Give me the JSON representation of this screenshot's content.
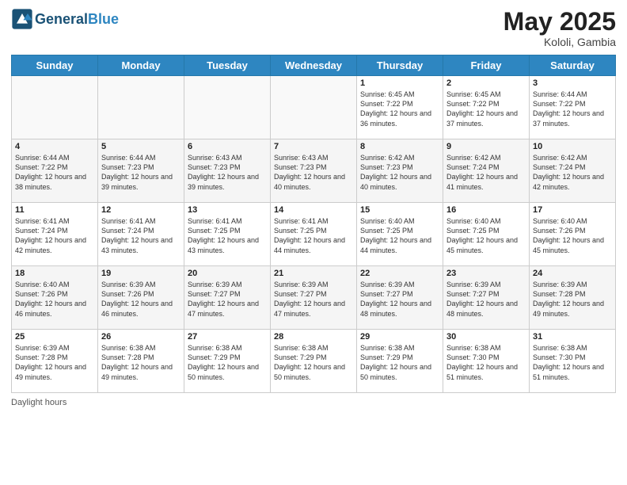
{
  "logo": {
    "general": "General",
    "blue": "Blue"
  },
  "title": "May 2025",
  "subtitle": "Kololi, Gambia",
  "days_of_week": [
    "Sunday",
    "Monday",
    "Tuesday",
    "Wednesday",
    "Thursday",
    "Friday",
    "Saturday"
  ],
  "weeks": [
    [
      {
        "day": "",
        "info": ""
      },
      {
        "day": "",
        "info": ""
      },
      {
        "day": "",
        "info": ""
      },
      {
        "day": "",
        "info": ""
      },
      {
        "day": "1",
        "info": "Sunrise: 6:45 AM\nSunset: 7:22 PM\nDaylight: 12 hours and 36 minutes."
      },
      {
        "day": "2",
        "info": "Sunrise: 6:45 AM\nSunset: 7:22 PM\nDaylight: 12 hours and 37 minutes."
      },
      {
        "day": "3",
        "info": "Sunrise: 6:44 AM\nSunset: 7:22 PM\nDaylight: 12 hours and 37 minutes."
      }
    ],
    [
      {
        "day": "4",
        "info": "Sunrise: 6:44 AM\nSunset: 7:22 PM\nDaylight: 12 hours and 38 minutes."
      },
      {
        "day": "5",
        "info": "Sunrise: 6:44 AM\nSunset: 7:23 PM\nDaylight: 12 hours and 39 minutes."
      },
      {
        "day": "6",
        "info": "Sunrise: 6:43 AM\nSunset: 7:23 PM\nDaylight: 12 hours and 39 minutes."
      },
      {
        "day": "7",
        "info": "Sunrise: 6:43 AM\nSunset: 7:23 PM\nDaylight: 12 hours and 40 minutes."
      },
      {
        "day": "8",
        "info": "Sunrise: 6:42 AM\nSunset: 7:23 PM\nDaylight: 12 hours and 40 minutes."
      },
      {
        "day": "9",
        "info": "Sunrise: 6:42 AM\nSunset: 7:24 PM\nDaylight: 12 hours and 41 minutes."
      },
      {
        "day": "10",
        "info": "Sunrise: 6:42 AM\nSunset: 7:24 PM\nDaylight: 12 hours and 42 minutes."
      }
    ],
    [
      {
        "day": "11",
        "info": "Sunrise: 6:41 AM\nSunset: 7:24 PM\nDaylight: 12 hours and 42 minutes."
      },
      {
        "day": "12",
        "info": "Sunrise: 6:41 AM\nSunset: 7:24 PM\nDaylight: 12 hours and 43 minutes."
      },
      {
        "day": "13",
        "info": "Sunrise: 6:41 AM\nSunset: 7:25 PM\nDaylight: 12 hours and 43 minutes."
      },
      {
        "day": "14",
        "info": "Sunrise: 6:41 AM\nSunset: 7:25 PM\nDaylight: 12 hours and 44 minutes."
      },
      {
        "day": "15",
        "info": "Sunrise: 6:40 AM\nSunset: 7:25 PM\nDaylight: 12 hours and 44 minutes."
      },
      {
        "day": "16",
        "info": "Sunrise: 6:40 AM\nSunset: 7:25 PM\nDaylight: 12 hours and 45 minutes."
      },
      {
        "day": "17",
        "info": "Sunrise: 6:40 AM\nSunset: 7:26 PM\nDaylight: 12 hours and 45 minutes."
      }
    ],
    [
      {
        "day": "18",
        "info": "Sunrise: 6:40 AM\nSunset: 7:26 PM\nDaylight: 12 hours and 46 minutes."
      },
      {
        "day": "19",
        "info": "Sunrise: 6:39 AM\nSunset: 7:26 PM\nDaylight: 12 hours and 46 minutes."
      },
      {
        "day": "20",
        "info": "Sunrise: 6:39 AM\nSunset: 7:27 PM\nDaylight: 12 hours and 47 minutes."
      },
      {
        "day": "21",
        "info": "Sunrise: 6:39 AM\nSunset: 7:27 PM\nDaylight: 12 hours and 47 minutes."
      },
      {
        "day": "22",
        "info": "Sunrise: 6:39 AM\nSunset: 7:27 PM\nDaylight: 12 hours and 48 minutes."
      },
      {
        "day": "23",
        "info": "Sunrise: 6:39 AM\nSunset: 7:27 PM\nDaylight: 12 hours and 48 minutes."
      },
      {
        "day": "24",
        "info": "Sunrise: 6:39 AM\nSunset: 7:28 PM\nDaylight: 12 hours and 49 minutes."
      }
    ],
    [
      {
        "day": "25",
        "info": "Sunrise: 6:39 AM\nSunset: 7:28 PM\nDaylight: 12 hours and 49 minutes."
      },
      {
        "day": "26",
        "info": "Sunrise: 6:38 AM\nSunset: 7:28 PM\nDaylight: 12 hours and 49 minutes."
      },
      {
        "day": "27",
        "info": "Sunrise: 6:38 AM\nSunset: 7:29 PM\nDaylight: 12 hours and 50 minutes."
      },
      {
        "day": "28",
        "info": "Sunrise: 6:38 AM\nSunset: 7:29 PM\nDaylight: 12 hours and 50 minutes."
      },
      {
        "day": "29",
        "info": "Sunrise: 6:38 AM\nSunset: 7:29 PM\nDaylight: 12 hours and 50 minutes."
      },
      {
        "day": "30",
        "info": "Sunrise: 6:38 AM\nSunset: 7:30 PM\nDaylight: 12 hours and 51 minutes."
      },
      {
        "day": "31",
        "info": "Sunrise: 6:38 AM\nSunset: 7:30 PM\nDaylight: 12 hours and 51 minutes."
      }
    ]
  ],
  "footer": "Daylight hours"
}
